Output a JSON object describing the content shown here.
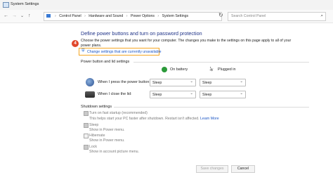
{
  "window": {
    "title": "System Settings"
  },
  "nav": {
    "back": "←",
    "forward": "→",
    "recent": "⌄",
    "up": "↑",
    "refresh": "↻"
  },
  "breadcrumbs": [
    "Control Panel",
    "Hardware and Sound",
    "Power Options",
    "System Settings"
  ],
  "search": {
    "placeholder": "Search Control Panel"
  },
  "main": {
    "heading": "Define power buttons and turn on password protection",
    "description": "Choose the power settings that you want for your computer. The changes you make to the settings on this page apply to all of your power plans.",
    "step_badge": "4",
    "change_link": "Change settings that are currently unavailable"
  },
  "power_section": {
    "title": "Power button and lid settings",
    "col_battery": "On battery",
    "col_plugged": "Plugged in",
    "rows": [
      {
        "label": "When I press the power button:",
        "battery": "Sleep",
        "plugged": "Sleep"
      },
      {
        "label": "When I close the lid:",
        "battery": "Sleep",
        "plugged": "Sleep"
      }
    ]
  },
  "shutdown_section": {
    "title": "Shutdown settings",
    "items": [
      {
        "label": "Turn on fast startup (recommended)",
        "desc": "This helps start your PC faster after shutdown. Restart isn't affected.",
        "link": "Learn More",
        "checked": true
      },
      {
        "label": "Sleep",
        "desc": "Show in Power menu.",
        "checked": true
      },
      {
        "label": "Hibernate",
        "desc": "Show in Power menu.",
        "checked": false
      },
      {
        "label": "Lock",
        "desc": "Show in account picture menu.",
        "checked": true
      }
    ]
  },
  "footer": {
    "save": "Save changes",
    "cancel": "Cancel"
  },
  "colors": {
    "heading": "#1e3287",
    "link": "#1a55c4",
    "highlight": "#f5a623",
    "badge": "#e0462a"
  },
  "icons": {
    "window": "control-panel-icon",
    "uac": "shield-icon",
    "battery": "battery-icon",
    "plug": "plug-icon",
    "power_button": "power-button-icon",
    "lid": "laptop-lid-icon",
    "search": "search-icon"
  }
}
